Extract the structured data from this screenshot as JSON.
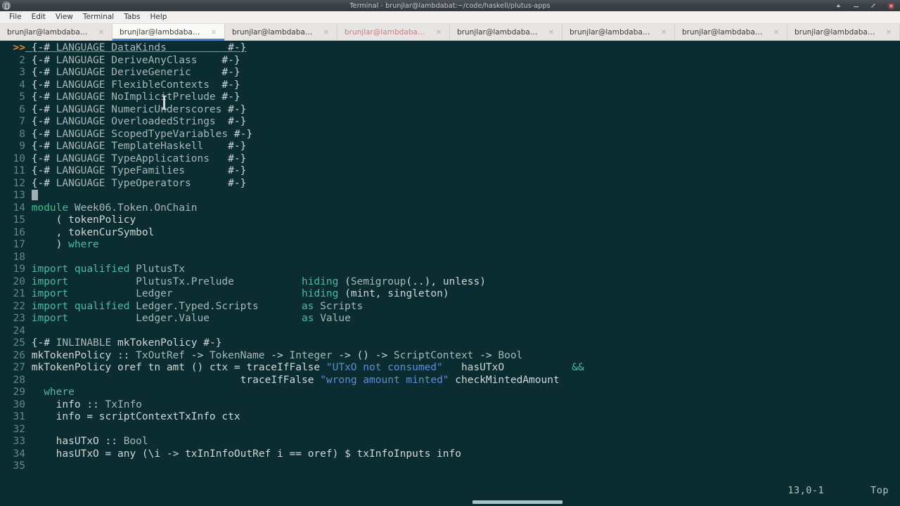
{
  "window": {
    "title": "Terminal - brunjlar@lambdabat:~/code/haskell/plutus-apps",
    "icon": "terminal-icon",
    "controls": {
      "minimize": "minimize",
      "maximize": "maximize",
      "close": "close"
    }
  },
  "menubar": {
    "items": [
      {
        "label": "File"
      },
      {
        "label": "Edit"
      },
      {
        "label": "View"
      },
      {
        "label": "Terminal"
      },
      {
        "label": "Tabs"
      },
      {
        "label": "Help"
      }
    ]
  },
  "tabs": [
    {
      "label": "brunjlar@lambdabat:~/co...",
      "active": false,
      "alert": false
    },
    {
      "label": "brunjlar@lambdabat:~/co...",
      "active": true,
      "alert": false
    },
    {
      "label": "brunjlar@lambdabat:~/co...",
      "active": false,
      "alert": false
    },
    {
      "label": "brunjlar@lambdabat:~/co...",
      "active": false,
      "alert": true
    },
    {
      "label": "brunjlar@lambdabat:~/co...",
      "active": false,
      "alert": false
    },
    {
      "label": "brunjlar@lambdabat:~/co...",
      "active": false,
      "alert": false
    },
    {
      "label": "brunjlar@lambdabat:~/co...",
      "active": false,
      "alert": false
    },
    {
      "label": "brunjlar@lambdabat:~/co...",
      "active": false,
      "alert": false
    }
  ],
  "editor": {
    "cursor_marker": ">>",
    "cursor_line": 13,
    "lines": [
      {
        "n": ">>",
        "current": true,
        "text": "{-# LANGUAGE DataKinds          #-}"
      },
      {
        "n": "2",
        "text": "{-# LANGUAGE DeriveAnyClass    #-}"
      },
      {
        "n": "3",
        "text": "{-# LANGUAGE DeriveGeneric     #-}"
      },
      {
        "n": "4",
        "text": "{-# LANGUAGE FlexibleContexts  #-}"
      },
      {
        "n": "5",
        "text": "{-# LANGUAGE NoImplicitPrelude #-}"
      },
      {
        "n": "6",
        "text": "{-# LANGUAGE NumericUnderscores #-}"
      },
      {
        "n": "7",
        "text": "{-# LANGUAGE OverloadedStrings  #-}"
      },
      {
        "n": "8",
        "text": "{-# LANGUAGE ScopedTypeVariables #-}"
      },
      {
        "n": "9",
        "text": "{-# LANGUAGE TemplateHaskell    #-}"
      },
      {
        "n": "10",
        "text": "{-# LANGUAGE TypeApplications   #-}"
      },
      {
        "n": "11",
        "text": "{-# LANGUAGE TypeFamilies       #-}"
      },
      {
        "n": "12",
        "text": "{-# LANGUAGE TypeOperators      #-}"
      },
      {
        "n": "13",
        "text": ""
      },
      {
        "n": "14",
        "text": "module Week06.Token.OnChain"
      },
      {
        "n": "15",
        "text": "    ( tokenPolicy"
      },
      {
        "n": "16",
        "text": "    , tokenCurSymbol"
      },
      {
        "n": "17",
        "text": "    ) where"
      },
      {
        "n": "18",
        "text": ""
      },
      {
        "n": "19",
        "text": "import qualified PlutusTx"
      },
      {
        "n": "20",
        "text": "import           PlutusTx.Prelude           hiding (Semigroup(..), unless)"
      },
      {
        "n": "21",
        "text": "import           Ledger                     hiding (mint, singleton)"
      },
      {
        "n": "22",
        "text": "import qualified Ledger.Typed.Scripts       as Scripts"
      },
      {
        "n": "23",
        "text": "import           Ledger.Value               as Value"
      },
      {
        "n": "24",
        "text": ""
      },
      {
        "n": "25",
        "text": "{-# INLINABLE mkTokenPolicy #-}"
      },
      {
        "n": "26",
        "text": "mkTokenPolicy :: TxOutRef -> TokenName -> Integer -> () -> ScriptContext -> Bool"
      },
      {
        "n": "27",
        "text": "mkTokenPolicy oref tn amt () ctx = traceIfFalse \"UTxO not consumed\"   hasUTxO           &&"
      },
      {
        "n": "28",
        "text": "                                  traceIfFalse \"wrong amount minted\" checkMintedAmount"
      },
      {
        "n": "29",
        "text": "  where"
      },
      {
        "n": "30",
        "text": "    info :: TxInfo"
      },
      {
        "n": "31",
        "text": "    info = scriptContextTxInfo ctx"
      },
      {
        "n": "32",
        "text": ""
      },
      {
        "n": "33",
        "text": "    hasUTxO :: Bool"
      },
      {
        "n": "34",
        "text": "    hasUTxO = any (\\i -> txInInfoOutRef i == oref) $ txInfoInputs info"
      },
      {
        "n": "35",
        "text": ""
      }
    ]
  },
  "statusline": {
    "position": "13,0-1",
    "scroll_state": "Top"
  },
  "colors": {
    "terminal_bg": "#0b2c30",
    "keyword": "#4fb8a8",
    "module_keyword": "#3fbf8f",
    "string": "#5b8fd6",
    "text": "#cfd8d8",
    "linenumber": "#5f8b8c",
    "cursor_marker": "#d98c36",
    "tab_active_accent": "#3d84d6",
    "tab_alert": "#c77c86"
  }
}
